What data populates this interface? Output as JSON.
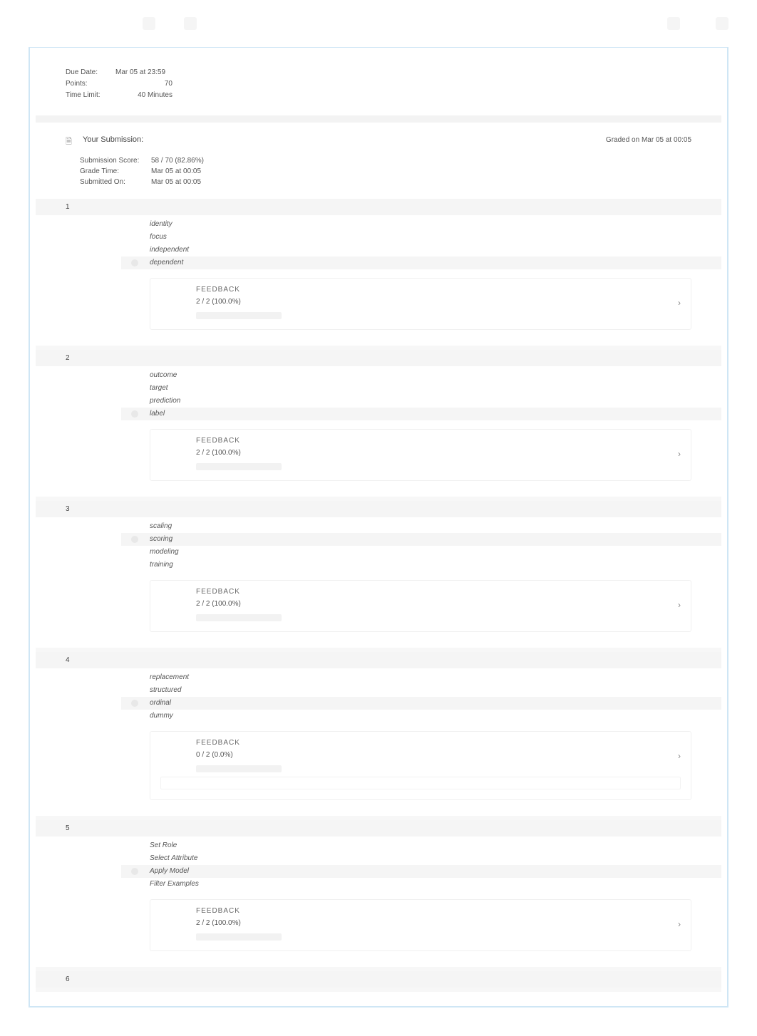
{
  "meta": {
    "due_label": "Due Date:",
    "due_val": "Mar 05 at 23:59",
    "points_label": "Points:",
    "points_val": "70",
    "time_label": "Time Limit:",
    "time_val": "40 Minutes"
  },
  "submission": {
    "heading": "Your Submission:",
    "graded": "Graded on Mar 05 at 00:05",
    "score_label": "Submission Score:",
    "score_val": "58 / 70 (82.86%)",
    "grade_time_label": "Grade Time:",
    "grade_time_val": "Mar 05 at 00:05",
    "submitted_label": "Submitted On:",
    "submitted_val": "Mar 05 at 00:05"
  },
  "feedback_label": "FEEDBACK",
  "questions": [
    {
      "num": "1",
      "options": [
        "identity",
        "focus",
        "independent",
        "dependent"
      ],
      "selected": 3,
      "score": "2 / 2 (100.0%)"
    },
    {
      "num": "2",
      "options": [
        "outcome",
        "target",
        "prediction",
        "label"
      ],
      "selected": 3,
      "score": "2 / 2 (100.0%)"
    },
    {
      "num": "3",
      "options": [
        "scaling",
        "scoring",
        "modeling",
        "training"
      ],
      "selected": 1,
      "score": "2 / 2 (100.0%)"
    },
    {
      "num": "4",
      "options": [
        "replacement",
        "structured",
        "ordinal",
        "dummy"
      ],
      "selected": 2,
      "score": "0 / 2 (0.0%)",
      "extra_box": true
    },
    {
      "num": "5",
      "options": [
        "Set Role",
        "Select Attribute",
        "Apply Model",
        "Filter Examples"
      ],
      "selected": 2,
      "score": "2 / 2 (100.0%)"
    },
    {
      "num": "6",
      "options": [],
      "selected": -1,
      "score": ""
    }
  ]
}
